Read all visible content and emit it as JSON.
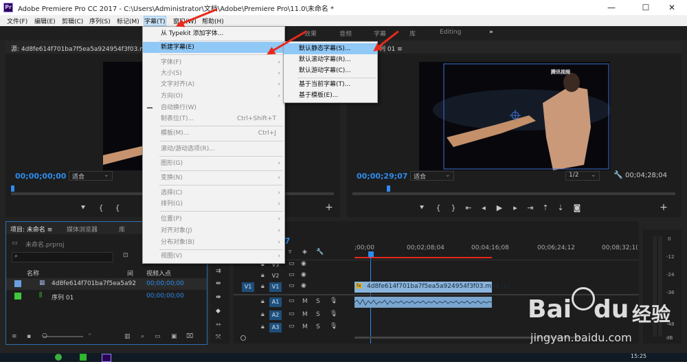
{
  "window": {
    "title": "Adobe Premiere Pro CC 2017 - C:\\Users\\Administrator\\文档\\Adobe\\Premiere Pro\\11.0\\未命名 *",
    "logo": "Pr",
    "min": "—",
    "max": "☐",
    "close": "✕"
  },
  "menubar": [
    "文件(F)",
    "编辑(E)",
    "剪辑(C)",
    "序列(S)",
    "标记(M)",
    "字幕(T)",
    "窗口(W)",
    "帮助(H)"
  ],
  "workspace_tabs": [
    "效果",
    "音频",
    "字幕",
    "库",
    "Editing",
    "»"
  ],
  "source_monitor": {
    "title": "源: 4d8fe614f701ba7f5ea5a924954f3f03.mp4 ≡",
    "timecode": "00;00;00;00",
    "fit": "适合",
    "duration": "00;04;28;04"
  },
  "program_monitor": {
    "title": "列 01 ≡",
    "timecode": "00;00;29;07",
    "fit": "适合",
    "resolution": "1/2",
    "duration": "00;04;28;04",
    "watermark": "腾讯视频"
  },
  "project_panel": {
    "tabs": [
      "项目: 未命名 ≡",
      "媒体浏览器",
      "库"
    ],
    "project_file": "未命名.prproj",
    "col_name": "名称",
    "col_rate": "间",
    "col_in": "视频入点",
    "items": [
      {
        "name": "4d8fe614f701ba7f5ea5a92",
        "in": "00;00;00;00",
        "color": "#6aa0e0"
      },
      {
        "name": "序列 01",
        "in": "00;00;00;00",
        "color": "#3ec83e"
      }
    ]
  },
  "timeline": {
    "timecode": "7",
    "ruler": [
      ";00;00",
      "00;02;08;04",
      "00;04;16;08",
      "00;06;24;12",
      "00;08;32;1("
    ],
    "tracks": [
      {
        "label": "V3",
        "src": ""
      },
      {
        "label": "V2",
        "src": ""
      },
      {
        "label": "V1",
        "src": "V1"
      },
      {
        "label": "A1",
        "src": ""
      },
      {
        "label": "A2",
        "src": ""
      },
      {
        "label": "A3",
        "src": ""
      }
    ],
    "clip_label": "4d8fe614f701ba7f5ea5a924954f3f03.mp4 [V]",
    "clip_fx": "fx",
    "meter_scale": [
      "0",
      "-12",
      "-24",
      "-36",
      "-48",
      "dB"
    ],
    "mute": "M",
    "solo": "S"
  },
  "caption_menu": {
    "items": [
      {
        "label": "从 Typekit 添加字体...",
        "enabled": true
      },
      {
        "label": "新建字幕(E)",
        "enabled": true,
        "submenu": true,
        "highlight": true
      },
      {
        "label": "字体(F)",
        "enabled": false,
        "submenu": true
      },
      {
        "label": "大小(S)",
        "enabled": false,
        "submenu": true
      },
      {
        "label": "文字对齐(A)",
        "enabled": false,
        "submenu": true
      },
      {
        "label": "方向(O)",
        "enabled": false,
        "submenu": true
      },
      {
        "label": "自动换行(W)",
        "enabled": false
      },
      {
        "label": "制表位(T)...",
        "enabled": false,
        "shortcut": "Ctrl+Shift+T"
      },
      {
        "label": "模板(M)...",
        "enabled": false,
        "shortcut": "Ctrl+J"
      },
      {
        "label": "滚动/游动选项(R)...",
        "enabled": false
      },
      {
        "label": "图形(G)",
        "enabled": false,
        "submenu": true
      },
      {
        "label": "变换(N)",
        "enabled": false,
        "submenu": true
      },
      {
        "label": "选择(C)",
        "enabled": false,
        "submenu": true
      },
      {
        "label": "排列(G)",
        "enabled": false,
        "submenu": true
      },
      {
        "label": "位置(P)",
        "enabled": false,
        "submenu": true
      },
      {
        "label": "对齐对象(J)",
        "enabled": false,
        "submenu": true
      },
      {
        "label": "分布对象(B)",
        "enabled": false,
        "submenu": true
      },
      {
        "label": "视图(V)",
        "enabled": false,
        "submenu": true
      }
    ]
  },
  "new_caption_submenu": {
    "items": [
      {
        "label": "默认静态字幕(S)...",
        "highlight": true
      },
      {
        "label": "默认滚动字幕(R)..."
      },
      {
        "label": "默认游动字幕(C)..."
      },
      {
        "label": "基于当前字幕(T)..."
      },
      {
        "label": "基于模板(E)..."
      }
    ]
  },
  "baidu": {
    "logo": "Bai",
    "du": "du",
    "brand": "经验",
    "url": "jingyan.baidu.com"
  },
  "taskbar": {
    "clock": "15:25"
  },
  "colors": {
    "accent_blue": "#2d8ceb",
    "playhead": "#e8291b",
    "clip_video": "#8ab4dc",
    "arrow": "#e8291b"
  }
}
